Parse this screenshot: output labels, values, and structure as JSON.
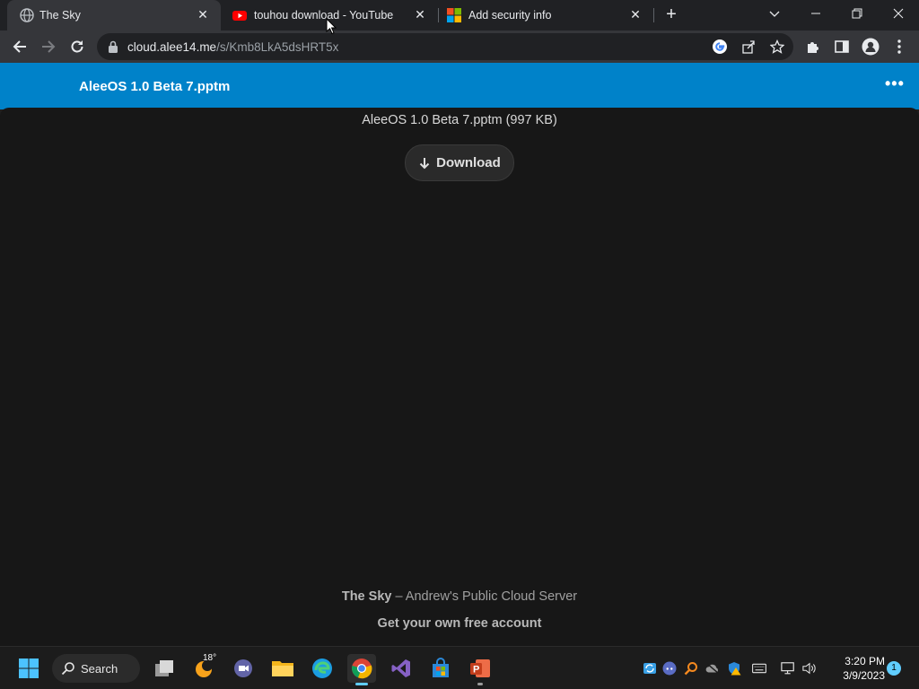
{
  "browser": {
    "tabs": [
      {
        "title": "The Sky",
        "favicon": "globe-icon",
        "active": true
      },
      {
        "title": "touhou download - YouTube",
        "favicon": "youtube-icon",
        "active": false
      },
      {
        "title": "Add security info",
        "favicon": "microsoft-icon",
        "active": false
      }
    ],
    "url_host": "cloud.alee14.me",
    "url_path": "/s/Kmb8LkA5dsHRT5x"
  },
  "app": {
    "header_title": "AleeOS 1.0 Beta 7.pptm",
    "menu_glyph": "•••",
    "accent_color": "#0082c9"
  },
  "file": {
    "info": "AleeOS 1.0 Beta 7.pptm (997 KB)",
    "download_label": "Download"
  },
  "footer": {
    "brand": "The Sky",
    "tagline": " – Andrew's Public Cloud Server",
    "signup": "Get your own free account"
  },
  "taskbar": {
    "search_label": "Search",
    "weather_temp": "18°",
    "time": "3:20 PM",
    "date": "3/9/2023",
    "notifications": "1"
  }
}
